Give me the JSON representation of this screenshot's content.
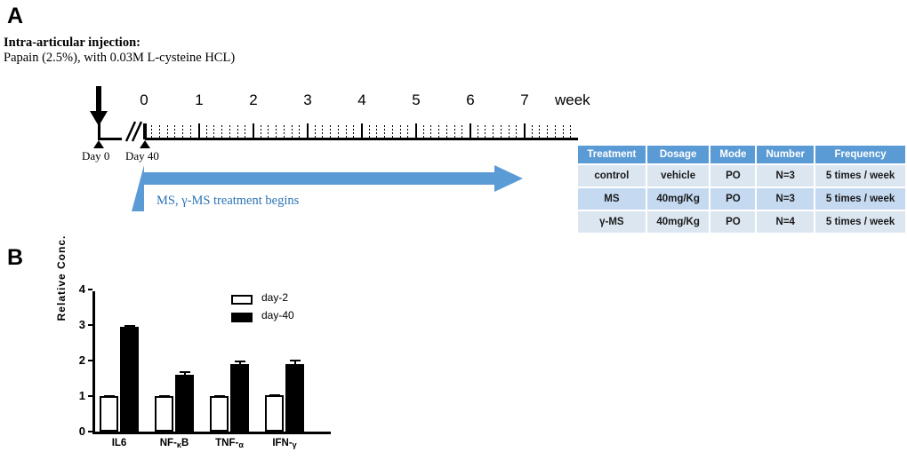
{
  "panels": {
    "a_label": "A",
    "b_label": "B"
  },
  "injection": {
    "title": "Intra-articular injection:",
    "detail": "Papain (2.5%), with 0.03M L-cysteine HCL)"
  },
  "timeline": {
    "unit_label": "week",
    "week_ticks": [
      "0",
      "1",
      "2",
      "3",
      "4",
      "5",
      "6",
      "7"
    ],
    "minor_ticks_per_week": 6,
    "markers": [
      {
        "label": "Day 0"
      },
      {
        "label": "Day 40"
      }
    ],
    "treatment_arrow_label": "MS, γ-MS treatment begins",
    "arrow_color": "#5B9BD5",
    "arrow_text_color": "#2E74B5"
  },
  "table": {
    "header_color": "#5B9BD5",
    "row_colors": [
      "#DCE6F1",
      "#C5D9F1"
    ],
    "columns": [
      "Treatment",
      "Dosage",
      "Mode",
      "Number",
      "Frequency"
    ],
    "rows": [
      [
        "control",
        "vehicle",
        "PO",
        "N=3",
        "5 times / week"
      ],
      [
        "MS",
        "40mg/Kg",
        "PO",
        "N=3",
        "5 times / week"
      ],
      [
        "γ-MS",
        "40mg/Kg",
        "PO",
        "N=4",
        "5 times / week"
      ]
    ]
  },
  "chart_data": {
    "type": "bar",
    "title": "",
    "xlabel": "",
    "ylabel": "Relative Conc.",
    "ylim": [
      0,
      4
    ],
    "yticks": [
      "0",
      "1",
      "2",
      "3",
      "4"
    ],
    "grid": false,
    "legend_position": "top-right",
    "categories": [
      "IL6",
      "NF-κB",
      "TNF-α",
      "IFN-γ"
    ],
    "category_parts": [
      {
        "main": "IL6",
        "sub": ""
      },
      {
        "main": "NF-",
        "sub": "κ",
        "tail": "B"
      },
      {
        "main": "TNF-",
        "sub": "α",
        "tail": ""
      },
      {
        "main": "IFN-",
        "sub": "γ",
        "tail": ""
      }
    ],
    "series": [
      {
        "name": "day-2",
        "style": "open",
        "values": [
          1.0,
          1.0,
          1.0,
          1.02
        ],
        "errors": [
          0.02,
          0.03,
          0.03,
          0.04
        ]
      },
      {
        "name": "day-40",
        "style": "solid",
        "values": [
          2.95,
          1.6,
          1.9,
          1.9
        ],
        "errors": [
          0.05,
          0.09,
          0.1,
          0.13
        ]
      }
    ]
  }
}
